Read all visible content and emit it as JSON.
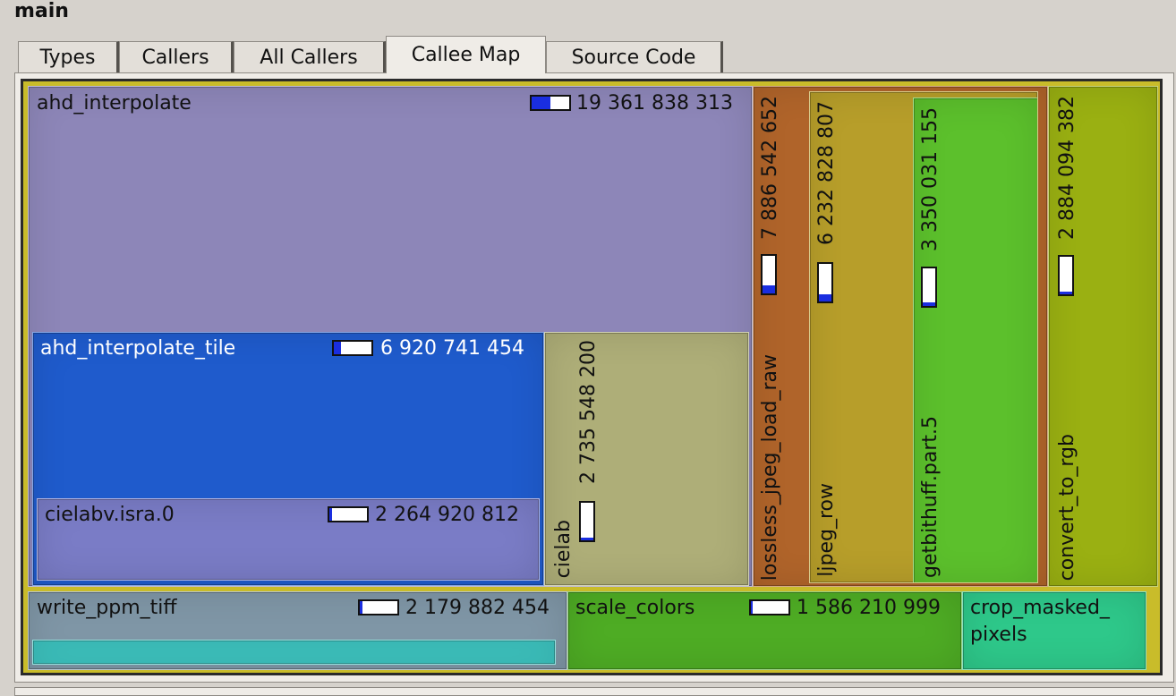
{
  "window": {
    "title": "main"
  },
  "tabs": [
    {
      "label": "Types",
      "active": false
    },
    {
      "label": "Callers",
      "active": false
    },
    {
      "label": "All Callers",
      "active": false
    },
    {
      "label": "Callee Map",
      "active": true
    },
    {
      "label": "Source Code",
      "active": false
    }
  ],
  "callee_map": {
    "ahd_interpolate": {
      "name": "ahd_interpolate",
      "cost": "19 361 838 313",
      "ratio": 0.5,
      "color": "#8d86b8"
    },
    "ahd_interpolate_tile": {
      "name": "ahd_interpolate_tile",
      "cost": "6 920 741 454",
      "ratio": 0.2,
      "color": "#1f5bcc"
    },
    "cielabv": {
      "name": "cielabv.isra.0",
      "cost": "2 264 920 812",
      "ratio": 0.06,
      "color": "#7a7cc6"
    },
    "cielab": {
      "name": "cielab",
      "cost": "2 735 548 200",
      "ratio": 0.08,
      "color": "#aeae78"
    },
    "lossless_jpeg_load_raw": {
      "name": "lossless_jpeg_load_raw",
      "cost": "7 886 542 652",
      "ratio": 0.22,
      "color": "#b0642a"
    },
    "ljpeg_row": {
      "name": "ljpeg_row",
      "cost": "6 232 828 807",
      "ratio": 0.18,
      "color": "#b79e2a"
    },
    "getbithuff": {
      "name": "getbithuff.part.5",
      "cost": "3 350 031 155",
      "ratio": 0.09,
      "color": "#5cc02c"
    },
    "convert_to_rgb": {
      "name": "convert_to_rgb",
      "cost": "2 884 094 382",
      "ratio": 0.08,
      "color": "#9ab012"
    },
    "write_ppm_tiff": {
      "name": "write_ppm_tiff",
      "cost": "2 179 882 454",
      "ratio": 0.06,
      "color": "#7f96a6"
    },
    "scale_colors": {
      "name": "scale_colors",
      "cost": "1 586 210 999",
      "ratio": 0.04,
      "color": "#4eac24"
    },
    "crop_masked_pixels": {
      "name_line1": "crop_masked_",
      "name_line2": "pixels",
      "color": "#2ec88a"
    }
  }
}
